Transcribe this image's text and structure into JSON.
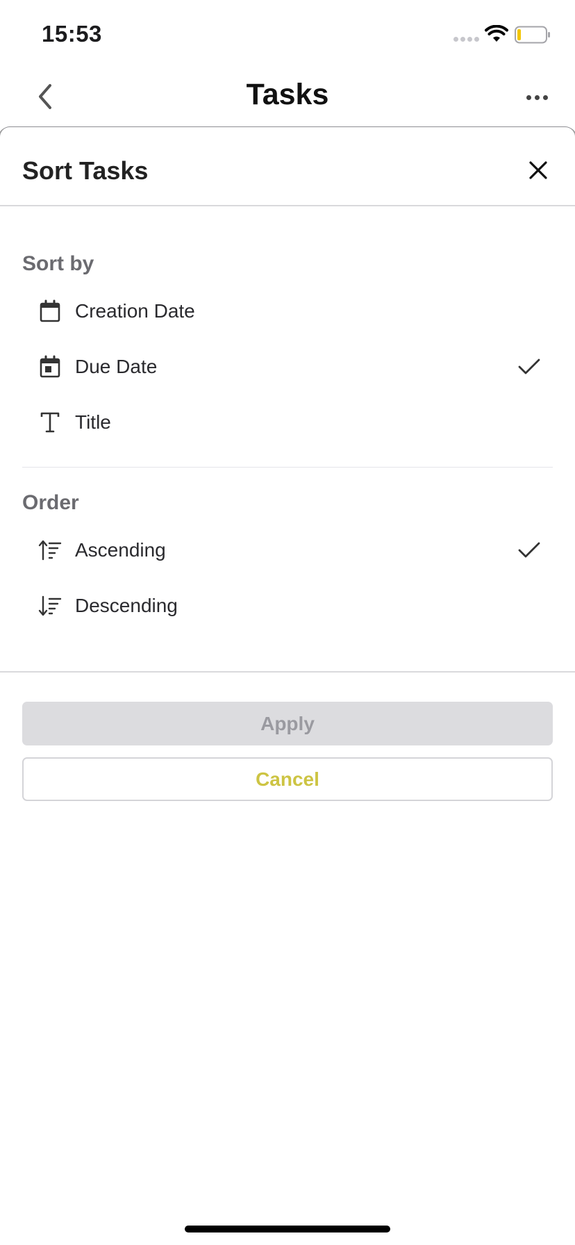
{
  "status_bar": {
    "time": "15:53"
  },
  "nav": {
    "title": "Tasks"
  },
  "sheet": {
    "title": "Sort Tasks",
    "sort_by": {
      "label": "Sort by",
      "options": [
        {
          "label": "Creation Date",
          "icon": "calendar-icon",
          "selected": false
        },
        {
          "label": "Due Date",
          "icon": "calendar-event-icon",
          "selected": true
        },
        {
          "label": "Title",
          "icon": "text-icon",
          "selected": false
        }
      ]
    },
    "order": {
      "label": "Order",
      "options": [
        {
          "label": "Ascending",
          "icon": "sort-ascending-icon",
          "selected": true
        },
        {
          "label": "Descending",
          "icon": "sort-descending-icon",
          "selected": false
        }
      ]
    },
    "apply_label": "Apply",
    "cancel_label": "Cancel"
  },
  "colors": {
    "accent": "#cdc443",
    "apply_bg": "#dcdcdf",
    "apply_text": "#9a9aa0",
    "section_label": "#6b6b70",
    "battery_level": "#f2c500"
  }
}
